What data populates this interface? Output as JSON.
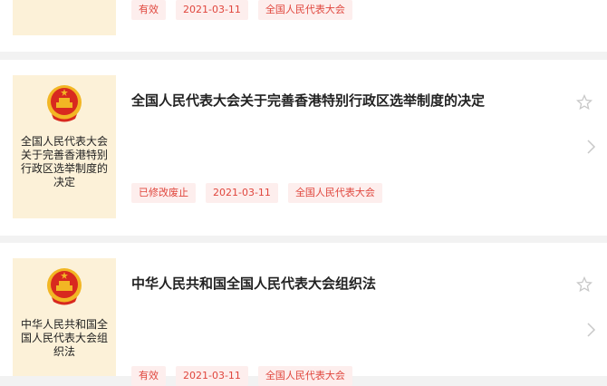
{
  "items": [
    {
      "thumb_text": "",
      "title": "",
      "status": "有效",
      "date": "2021-03-11",
      "agency": "全国人民代表大会"
    },
    {
      "thumb_text": "全国人民代表大会关于完善香港特别行政区选举制度的决定",
      "title": "全国人民代表大会关于完善香港特别行政区选举制度的决定",
      "status": "已修改废止",
      "date": "2021-03-11",
      "agency": "全国人民代表大会"
    },
    {
      "thumb_text": "中华人民共和国全国人民代表大会组织法",
      "title": "中华人民共和国全国人民代表大会组织法",
      "status": "有效",
      "date": "2021-03-11",
      "agency": "全国人民代表大会"
    }
  ],
  "icons": {
    "emblem": "national-emblem-icon",
    "favorite": "star-outline-icon",
    "open": "chevron-right-icon"
  },
  "colors": {
    "tag_bg": "#fdeeed",
    "tag_text": "#e0463d",
    "thumb_bg": "#fcf1d8",
    "emblem_red": "#d8291f",
    "emblem_gold": "#f2b624"
  }
}
